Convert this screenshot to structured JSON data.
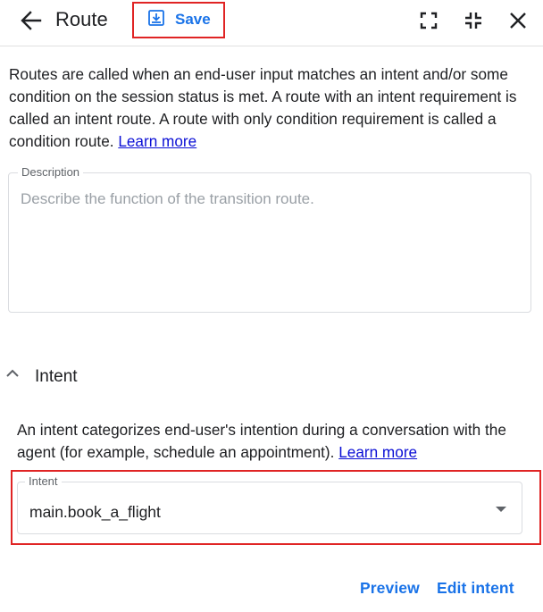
{
  "header": {
    "title": "Route",
    "save_label": "Save"
  },
  "intro": {
    "text": "Routes are called when an end-user input matches an intent and/or some condition on the session status is met. A route with an intent requirement is called an intent route. A route with only condition requirement is called a condition route. ",
    "link": "Learn more"
  },
  "description_field": {
    "label": "Description",
    "placeholder": "Describe the function of the transition route."
  },
  "intent_section": {
    "heading": "Intent",
    "text": "An intent categorizes end-user's intention during a conversation with the agent (for example, schedule an appointment). ",
    "link": "Learn more",
    "select_label": "Intent",
    "select_value": "main.book_a_flight"
  },
  "footer": {
    "preview_label": "Preview",
    "edit_intent_label": "Edit intent"
  },
  "colors": {
    "accent": "#1a73e8",
    "highlight": "#e02424",
    "link": "#0b0fd5"
  }
}
